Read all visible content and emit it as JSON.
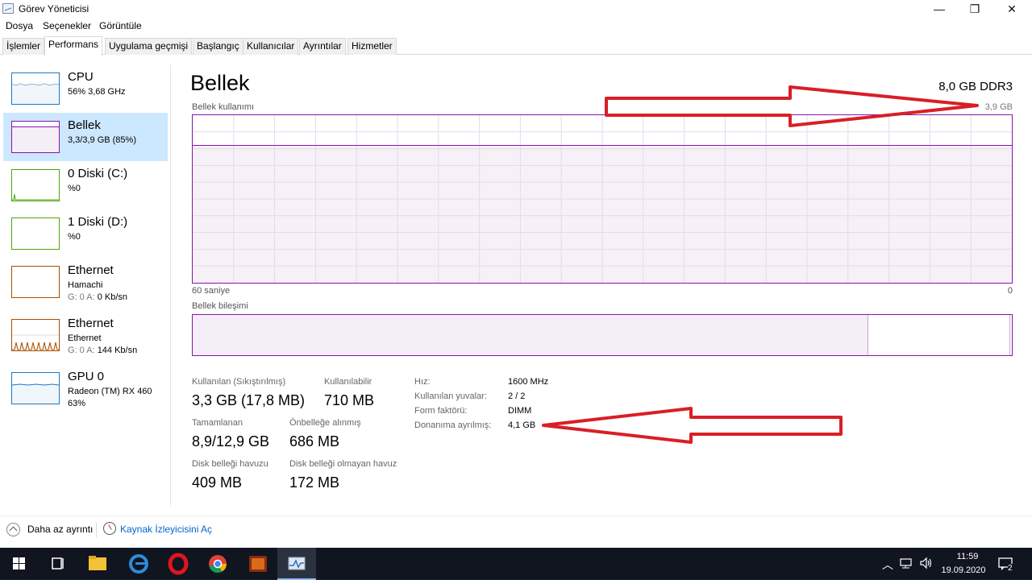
{
  "window": {
    "title": "Görev Yöneticisi",
    "controls": {
      "minimize": "—",
      "maximize": "❐",
      "close": "✕"
    }
  },
  "menu": [
    "Dosya",
    "Seçenekler",
    "Görüntüle"
  ],
  "tabs": [
    "İşlemler",
    "Performans",
    "Uygulama geçmişi",
    "Başlangıç",
    "Kullanıcılar",
    "Ayrıntılar",
    "Hizmetler"
  ],
  "active_tab": "Performans",
  "sidebar": {
    "items": [
      {
        "title": "CPU",
        "sub": "56%  3,68 GHz",
        "color": "#1b7ac3"
      },
      {
        "title": "Bellek",
        "sub": "3,3/3,9 GB (85%)",
        "color": "#8b12ae",
        "selected": true
      },
      {
        "title": "0 Diski (C:)",
        "sub": "%0",
        "color": "#4da60c"
      },
      {
        "title": "1 Diski (D:)",
        "sub": "%0",
        "color": "#4da60c"
      },
      {
        "title": "Ethernet",
        "sub": "Hamachi",
        "sub2_label": "G: 0 A: ",
        "sub2_value": "0 Kb/sn",
        "color": "#a74f01"
      },
      {
        "title": "Ethernet",
        "sub": "Ethernet",
        "sub2_label": "G: 0 A: ",
        "sub2_value": "144 Kb/sn",
        "color": "#a74f01"
      },
      {
        "title": "GPU 0",
        "sub": "Radeon (TM) RX 460",
        "sub3": "63%",
        "color": "#1b7ac3"
      }
    ]
  },
  "memory": {
    "title": "Bellek",
    "spec": "8,0 GB DDR3",
    "usage_label": "Bellek kullanımı",
    "usage_max": "3,9 GB",
    "time_left": "60 saniye",
    "time_right": "0",
    "usage_fraction": 0.82,
    "composition_label": "Bellek bileşimi",
    "composition_in_use_fraction": 0.825,
    "accent": "#8b12ae",
    "fill": "#f4eef6",
    "grid": "#e8d7ee"
  },
  "stats": {
    "in_use_label": "Kullanılan (Sıkıştırılmış)",
    "in_use_value": "3,3 GB (17,8 MB)",
    "available_label": "Kullanılabilir",
    "available_value": "710 MB",
    "committed_label": "Tamamlanan",
    "committed_value": "8,9/12,9 GB",
    "cached_label": "Önbelleğe alınmış",
    "cached_value": "686 MB",
    "paged_label": "Disk belleği havuzu",
    "paged_value": "409 MB",
    "nonpaged_label": "Disk belleği olmayan havuz",
    "nonpaged_value": "172 MB"
  },
  "specs": {
    "speed_label": "Hız:",
    "speed_value": "1600 MHz",
    "slots_label": "Kullanılan yuvalar:",
    "slots_value": "2 / 2",
    "form_label": "Form faktörü:",
    "form_value": "DIMM",
    "reserved_label": "Donanıma ayrılmış:",
    "reserved_value": "4,1 GB"
  },
  "footer": {
    "fewer_details": "Daha az ayrıntı",
    "resource_monitor": "Kaynak İzleyicisini Aç"
  },
  "taskbar": {
    "apps": [
      "windows-start",
      "task-view",
      "file-explorer",
      "edge",
      "opera",
      "chrome",
      "game-app",
      "task-manager"
    ],
    "time": "11:59",
    "date": "19.09.2020",
    "notification_count": "2"
  },
  "annotation_color": "#d81f26"
}
